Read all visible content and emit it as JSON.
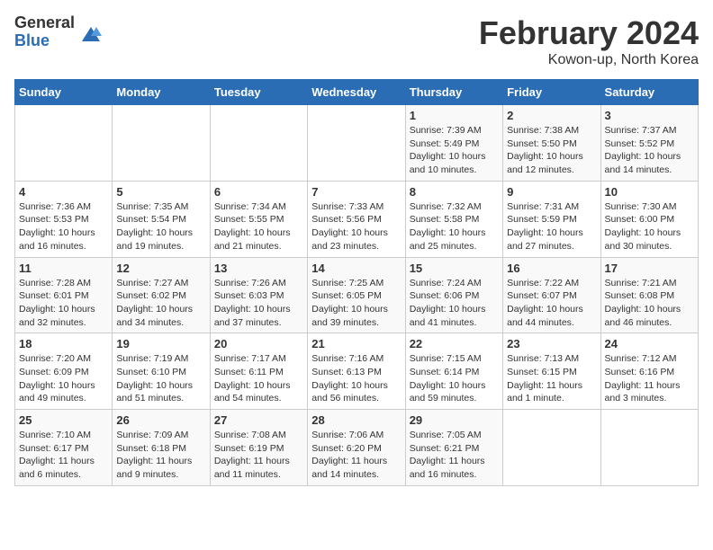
{
  "logo": {
    "general": "General",
    "blue": "Blue"
  },
  "title": "February 2024",
  "location": "Kowon-up, North Korea",
  "weekdays": [
    "Sunday",
    "Monday",
    "Tuesday",
    "Wednesday",
    "Thursday",
    "Friday",
    "Saturday"
  ],
  "weeks": [
    [
      {
        "day": "",
        "info": ""
      },
      {
        "day": "",
        "info": ""
      },
      {
        "day": "",
        "info": ""
      },
      {
        "day": "",
        "info": ""
      },
      {
        "day": "1",
        "info": "Sunrise: 7:39 AM\nSunset: 5:49 PM\nDaylight: 10 hours\nand 10 minutes."
      },
      {
        "day": "2",
        "info": "Sunrise: 7:38 AM\nSunset: 5:50 PM\nDaylight: 10 hours\nand 12 minutes."
      },
      {
        "day": "3",
        "info": "Sunrise: 7:37 AM\nSunset: 5:52 PM\nDaylight: 10 hours\nand 14 minutes."
      }
    ],
    [
      {
        "day": "4",
        "info": "Sunrise: 7:36 AM\nSunset: 5:53 PM\nDaylight: 10 hours\nand 16 minutes."
      },
      {
        "day": "5",
        "info": "Sunrise: 7:35 AM\nSunset: 5:54 PM\nDaylight: 10 hours\nand 19 minutes."
      },
      {
        "day": "6",
        "info": "Sunrise: 7:34 AM\nSunset: 5:55 PM\nDaylight: 10 hours\nand 21 minutes."
      },
      {
        "day": "7",
        "info": "Sunrise: 7:33 AM\nSunset: 5:56 PM\nDaylight: 10 hours\nand 23 minutes."
      },
      {
        "day": "8",
        "info": "Sunrise: 7:32 AM\nSunset: 5:58 PM\nDaylight: 10 hours\nand 25 minutes."
      },
      {
        "day": "9",
        "info": "Sunrise: 7:31 AM\nSunset: 5:59 PM\nDaylight: 10 hours\nand 27 minutes."
      },
      {
        "day": "10",
        "info": "Sunrise: 7:30 AM\nSunset: 6:00 PM\nDaylight: 10 hours\nand 30 minutes."
      }
    ],
    [
      {
        "day": "11",
        "info": "Sunrise: 7:28 AM\nSunset: 6:01 PM\nDaylight: 10 hours\nand 32 minutes."
      },
      {
        "day": "12",
        "info": "Sunrise: 7:27 AM\nSunset: 6:02 PM\nDaylight: 10 hours\nand 34 minutes."
      },
      {
        "day": "13",
        "info": "Sunrise: 7:26 AM\nSunset: 6:03 PM\nDaylight: 10 hours\nand 37 minutes."
      },
      {
        "day": "14",
        "info": "Sunrise: 7:25 AM\nSunset: 6:05 PM\nDaylight: 10 hours\nand 39 minutes."
      },
      {
        "day": "15",
        "info": "Sunrise: 7:24 AM\nSunset: 6:06 PM\nDaylight: 10 hours\nand 41 minutes."
      },
      {
        "day": "16",
        "info": "Sunrise: 7:22 AM\nSunset: 6:07 PM\nDaylight: 10 hours\nand 44 minutes."
      },
      {
        "day": "17",
        "info": "Sunrise: 7:21 AM\nSunset: 6:08 PM\nDaylight: 10 hours\nand 46 minutes."
      }
    ],
    [
      {
        "day": "18",
        "info": "Sunrise: 7:20 AM\nSunset: 6:09 PM\nDaylight: 10 hours\nand 49 minutes."
      },
      {
        "day": "19",
        "info": "Sunrise: 7:19 AM\nSunset: 6:10 PM\nDaylight: 10 hours\nand 51 minutes."
      },
      {
        "day": "20",
        "info": "Sunrise: 7:17 AM\nSunset: 6:11 PM\nDaylight: 10 hours\nand 54 minutes."
      },
      {
        "day": "21",
        "info": "Sunrise: 7:16 AM\nSunset: 6:13 PM\nDaylight: 10 hours\nand 56 minutes."
      },
      {
        "day": "22",
        "info": "Sunrise: 7:15 AM\nSunset: 6:14 PM\nDaylight: 10 hours\nand 59 minutes."
      },
      {
        "day": "23",
        "info": "Sunrise: 7:13 AM\nSunset: 6:15 PM\nDaylight: 11 hours\nand 1 minute."
      },
      {
        "day": "24",
        "info": "Sunrise: 7:12 AM\nSunset: 6:16 PM\nDaylight: 11 hours\nand 3 minutes."
      }
    ],
    [
      {
        "day": "25",
        "info": "Sunrise: 7:10 AM\nSunset: 6:17 PM\nDaylight: 11 hours\nand 6 minutes."
      },
      {
        "day": "26",
        "info": "Sunrise: 7:09 AM\nSunset: 6:18 PM\nDaylight: 11 hours\nand 9 minutes."
      },
      {
        "day": "27",
        "info": "Sunrise: 7:08 AM\nSunset: 6:19 PM\nDaylight: 11 hours\nand 11 minutes."
      },
      {
        "day": "28",
        "info": "Sunrise: 7:06 AM\nSunset: 6:20 PM\nDaylight: 11 hours\nand 14 minutes."
      },
      {
        "day": "29",
        "info": "Sunrise: 7:05 AM\nSunset: 6:21 PM\nDaylight: 11 hours\nand 16 minutes."
      },
      {
        "day": "",
        "info": ""
      },
      {
        "day": "",
        "info": ""
      }
    ]
  ]
}
